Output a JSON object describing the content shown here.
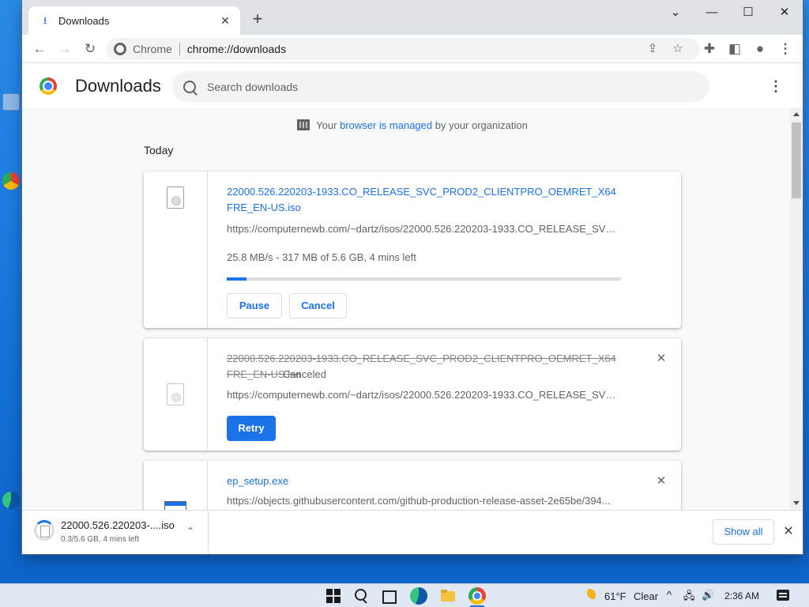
{
  "window": {
    "tab_title": "Downloads",
    "tab_close": "✕",
    "new_tab": "+",
    "minimize": "—",
    "maximize": "☐",
    "close": "✕",
    "chevron": "⌄"
  },
  "toolbar": {
    "site_label": "Chrome",
    "url": "chrome://downloads"
  },
  "header": {
    "title": "Downloads",
    "search_placeholder": "Search downloads"
  },
  "managed": {
    "prefix": "Your",
    "link": "browser is managed",
    "suffix": "by your organization"
  },
  "section": "Today",
  "downloads": [
    {
      "filename": "22000.526.220203-1933.CO_RELEASE_SVC_PROD2_CLIENTPRO_OEMRET_X64FRE_EN-US.iso",
      "url": "https://computernewb.com/~dartz/isos/22000.526.220203-1933.CO_RELEASE_SVC_PROD2_CLIENTPRO_OEMRET_X64FRE_EN-US.iso",
      "progress_text": "25.8 MB/s - 317 MB of 5.6 GB, 4 mins left",
      "progress": 0.05,
      "pause": "Pause",
      "cancel": "Cancel"
    },
    {
      "filename": "22000.526.220203-1933.CO_RELEASE_SVC_PROD2_CLIENTPRO_OEMRET_X64FRE_EN-US.iso",
      "status": "Canceled",
      "url": "https://computernewb.com/~dartz/isos/22000.526.220203-1933.CO_RELEASE_SVC_PROD2_CLIENTPRO_OEMRET_X64FRE_EN-US.iso",
      "retry": "Retry"
    },
    {
      "filename": "ep_setup.exe",
      "url": "https://objects.githubusercontent.com/github-production-release-asset-2e65be/394..."
    }
  ],
  "shelf": {
    "name": "22000.526.220203-....iso",
    "status": "0.3/5.6 GB, 4 mins left",
    "chevron": "⌃",
    "show_all": "Show all",
    "close": "✕"
  },
  "taskbar": {
    "temp": "61°F",
    "weather": "Clear",
    "tray_chevron": "^",
    "network": "🖧",
    "volume": "🔊",
    "time": "2:36 AM"
  },
  "colors": {
    "accent": "#1a73e8",
    "desktop": "#1b7ae0"
  }
}
